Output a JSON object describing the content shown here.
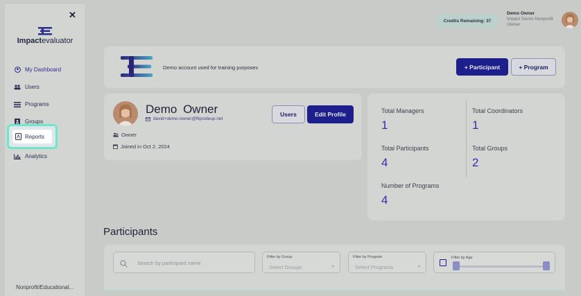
{
  "sidebar": {
    "logo_prefix": "Impact",
    "logo_suffix": "evaluator",
    "items": [
      {
        "label": "My Dashboard",
        "icon": "user-circle-icon"
      },
      {
        "label": "Users",
        "icon": "users-icon"
      },
      {
        "label": "Programs",
        "icon": "list-icon"
      },
      {
        "label": "Groups",
        "icon": "person-badge-icon"
      },
      {
        "label": "Reports",
        "icon": "pdf-file-icon"
      },
      {
        "label": "Analytics",
        "icon": "bar-chart-icon"
      }
    ],
    "footer": "Nonprofit/Educational..."
  },
  "topbar": {
    "credits": "Credits Remaining: 37",
    "user_name": "Demo  Owner",
    "user_org": "Impact Demo Nonprofit",
    "user_role": "Owner"
  },
  "banner": {
    "text": "Demo account used for training purposes",
    "add_participant": "+ Participant",
    "add_program": "+ Program"
  },
  "profile": {
    "name": "Demo  Owner",
    "email": "david+demo-owner@flipsideup.net",
    "role": "Owner",
    "joined": "Joined in Oct 2, 2024",
    "users_button": "Users",
    "edit_button": "Edit Profile"
  },
  "stats": {
    "total_managers_label": "Total Managers",
    "total_managers": "1",
    "total_coordinators_label": "Total Coordinators",
    "total_coordinators": "1",
    "total_participants_label": "Total Participants",
    "total_participants": "4",
    "total_groups_label": "Total Groups",
    "total_groups": "2",
    "programs_label": "Number of Programs",
    "programs": "4"
  },
  "participants": {
    "title": "Participants",
    "search_placeholder": "Search by participant name",
    "group_filter_label": "Filter by Group",
    "group_filter_value": "Select Groups",
    "program_filter_label": "Filter by Program",
    "program_filter_value": "Select Programs",
    "age_filter_label": "Filter by Age"
  },
  "colors": {
    "primary": "#1d1f8c",
    "accent_value": "#3b2aa8",
    "highlight": "#6ee7c6"
  }
}
